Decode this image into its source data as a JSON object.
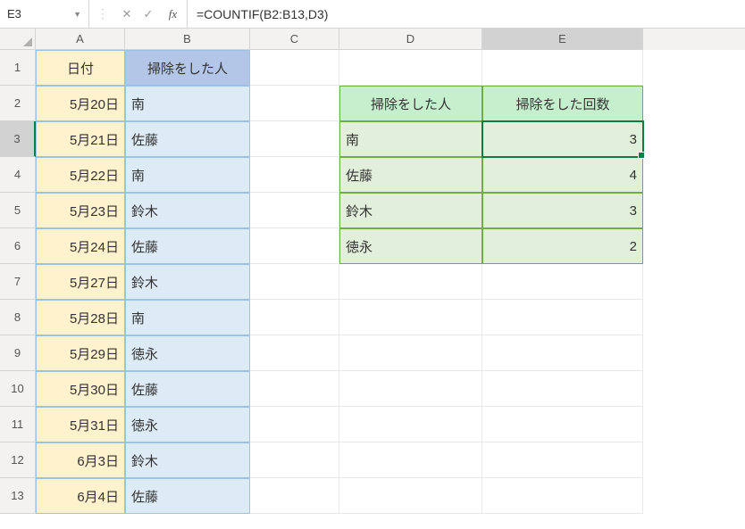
{
  "formula_bar": {
    "name_box": "E3",
    "formula": "=COUNTIF(B2:B13,D3)",
    "fx_label": "fx"
  },
  "columns": [
    "A",
    "B",
    "C",
    "D",
    "E"
  ],
  "row_numbers": [
    1,
    2,
    3,
    4,
    5,
    6,
    7,
    8,
    9,
    10,
    11,
    12,
    13
  ],
  "selected_cell": "E3",
  "headers": {
    "A": "日付",
    "B": "掃除をした人",
    "D": "掃除をした人",
    "E": "掃除をした回数"
  },
  "data_rows": [
    {
      "date": "5月20日",
      "person": "南"
    },
    {
      "date": "5月21日",
      "person": "佐藤"
    },
    {
      "date": "5月22日",
      "person": "南"
    },
    {
      "date": "5月23日",
      "person": "鈴木"
    },
    {
      "date": "5月24日",
      "person": "佐藤"
    },
    {
      "date": "5月27日",
      "person": "鈴木"
    },
    {
      "date": "5月28日",
      "person": "南"
    },
    {
      "date": "5月29日",
      "person": "徳永"
    },
    {
      "date": "5月30日",
      "person": "佐藤"
    },
    {
      "date": "5月31日",
      "person": "徳永"
    },
    {
      "date": "6月3日",
      "person": "鈴木"
    },
    {
      "date": "6月4日",
      "person": "佐藤"
    }
  ],
  "summary_rows": [
    {
      "person": "南",
      "count": 3
    },
    {
      "person": "佐藤",
      "count": 4
    },
    {
      "person": "鈴木",
      "count": 3
    },
    {
      "person": "徳永",
      "count": 2
    }
  ]
}
